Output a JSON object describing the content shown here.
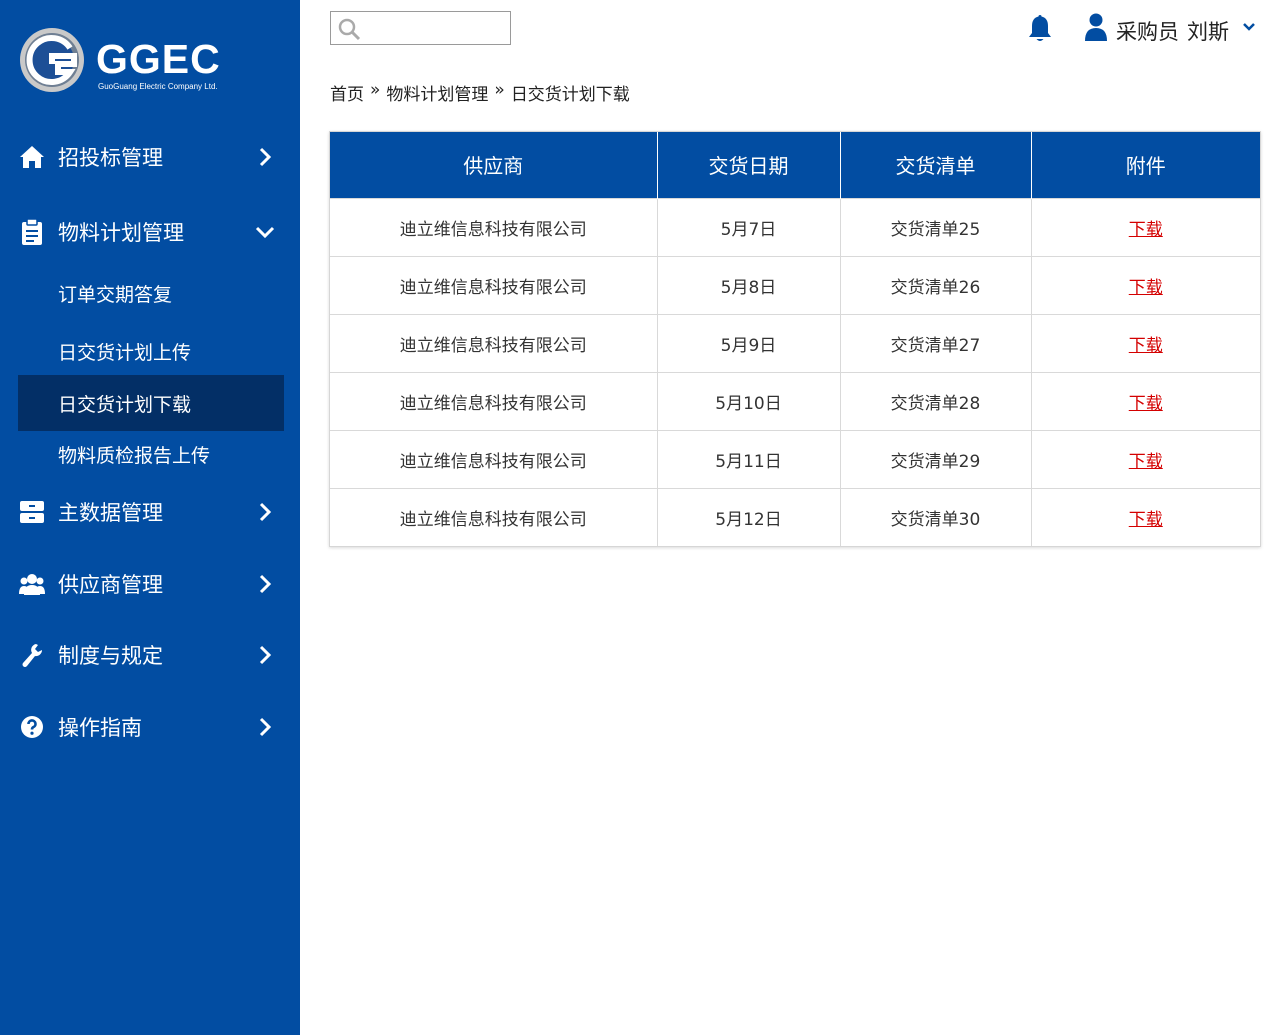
{
  "brand": {
    "name": "GGEC",
    "subtitle": "GuoGuang Electric Company Ltd."
  },
  "topbar": {
    "search_placeholder": "",
    "user_role": "采购员",
    "user_name": "刘斯"
  },
  "sidebar": {
    "items": [
      {
        "label": "招投标管理",
        "icon": "home-icon"
      },
      {
        "label": "物料计划管理",
        "icon": "clipboard-icon",
        "expanded": true
      },
      {
        "label": "主数据管理",
        "icon": "database-icon"
      },
      {
        "label": "供应商管理",
        "icon": "users-icon"
      },
      {
        "label": "制度与规定",
        "icon": "wrench-icon"
      },
      {
        "label": "操作指南",
        "icon": "question-icon"
      }
    ],
    "subitems": [
      {
        "label": "订单交期答复"
      },
      {
        "label": "日交货计划上传"
      },
      {
        "label": "日交货计划下载",
        "active": true
      },
      {
        "label": "物料质检报告上传"
      }
    ]
  },
  "breadcrumb": {
    "items": [
      "首页",
      "物料计划管理",
      "日交货计划下载"
    ],
    "separator": "»"
  },
  "table": {
    "headers": [
      "供应商",
      "交货日期",
      "交货清单",
      "附件"
    ],
    "rows": [
      {
        "supplier": "迪立维信息科技有限公司",
        "date": "5月7日",
        "list": "交货清单25",
        "attachment": "下载"
      },
      {
        "supplier": "迪立维信息科技有限公司",
        "date": "5月8日",
        "list": "交货清单26",
        "attachment": "下载"
      },
      {
        "supplier": "迪立维信息科技有限公司",
        "date": "5月9日",
        "list": "交货清单27",
        "attachment": "下载"
      },
      {
        "supplier": "迪立维信息科技有限公司",
        "date": "5月10日",
        "list": "交货清单28",
        "attachment": "下载"
      },
      {
        "supplier": "迪立维信息科技有限公司",
        "date": "5月11日",
        "list": "交货清单29",
        "attachment": "下载"
      },
      {
        "supplier": "迪立维信息科技有限公司",
        "date": "5月12日",
        "list": "交货清单30",
        "attachment": "下载"
      }
    ]
  },
  "colors": {
    "primary": "#024da2",
    "active_nav": "#032f66",
    "link": "#d40000"
  }
}
